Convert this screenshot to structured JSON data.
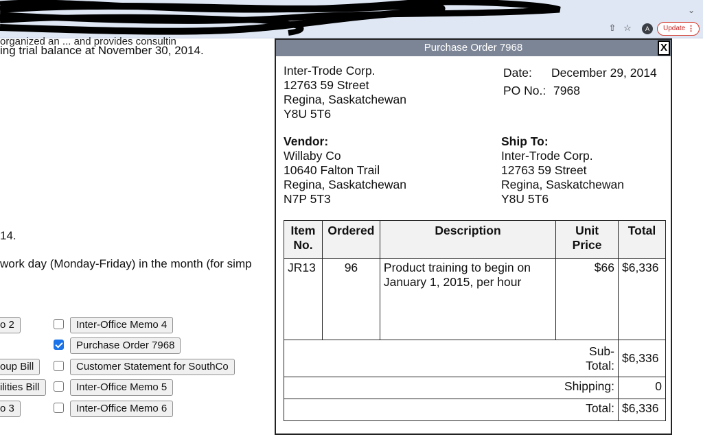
{
  "browser": {
    "update_label": "Update",
    "update_dots": "⋮",
    "avatar_letter": "A",
    "chevron": "⌄",
    "share_icon": "⇧",
    "star_icon": "☆"
  },
  "page": {
    "crossed_line": "organized an ... and provides consultin",
    "trial_balance": "ing trial balance at November 30, 2014.",
    "fragment_14": "14.",
    "work_day": " work day (Monday-Friday) in the month (for simp",
    "left_buttons": [
      "o 2",
      "oup Bill",
      "ilities Bill",
      "o 3"
    ],
    "doc_buttons": [
      {
        "label": "Inter-Office Memo 4",
        "checked": false
      },
      {
        "label": "Purchase Order 7968",
        "checked": true
      },
      {
        "label": "Customer Statement for SouthCo",
        "checked": false
      },
      {
        "label": "Inter-Office Memo 5",
        "checked": false
      },
      {
        "label": "Inter-Office Memo 6",
        "checked": false
      }
    ]
  },
  "modal": {
    "title": "Purchase Order 7968",
    "close_label": "X",
    "company": {
      "name": "Inter-Trode Corp.",
      "street": "12763 59 Street",
      "city": "Regina, Saskatchewan",
      "postal": "Y8U 5T6"
    },
    "date_label": "Date:",
    "date_value": "December 29, 2014",
    "po_label": "PO No.:",
    "po_value": "7968",
    "vendor": {
      "heading": "Vendor:",
      "name": "Willaby Co",
      "street": "10640 Falton Trail",
      "city": "Regina, Saskatchewan",
      "postal": "N7P 5T3"
    },
    "ship_to": {
      "heading": "Ship To:",
      "name": "Inter-Trode Corp.",
      "street": "12763 59 Street",
      "city": "Regina, Saskatchewan",
      "postal": "Y8U 5T6"
    },
    "table": {
      "headers": {
        "item": "Item No.",
        "ordered": "Ordered",
        "description": "Description",
        "unit_price": "Unit Price",
        "total": "Total"
      },
      "row": {
        "item": "JR13",
        "ordered": "96",
        "description": "Product training to begin on January 1, 2015, per hour",
        "unit_price": "$66",
        "total": "$6,336"
      },
      "subtotal_label": "Sub-Total:",
      "subtotal_value": "$6,336",
      "shipping_label": "Shipping:",
      "shipping_value": "0",
      "total_label": "Total:",
      "total_value": "$6,336"
    }
  }
}
